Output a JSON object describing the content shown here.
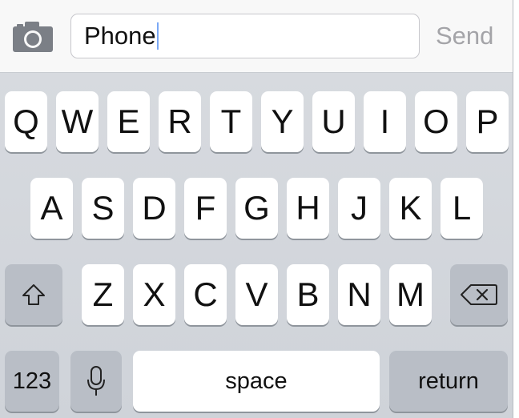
{
  "compose": {
    "camera_icon": "camera-icon",
    "message_value": "Phone",
    "send_label": "Send"
  },
  "keyboard": {
    "row1": [
      "Q",
      "W",
      "E",
      "R",
      "T",
      "Y",
      "U",
      "I",
      "O",
      "P"
    ],
    "row2": [
      "A",
      "S",
      "D",
      "F",
      "G",
      "H",
      "J",
      "K",
      "L"
    ],
    "row3": [
      "Z",
      "X",
      "C",
      "V",
      "B",
      "N",
      "M"
    ],
    "shift_icon": "shift-icon",
    "delete_icon": "backspace-icon",
    "numbers_label": "123",
    "mic_icon": "microphone-icon",
    "space_label": "space",
    "return_label": "return"
  },
  "colors": {
    "keyboard_bg": "#d1d5db",
    "key_bg": "#ffffff",
    "modifier_key_bg": "#b9bec6",
    "send_disabled": "#a4a4a8",
    "caret": "#7aa8f5"
  }
}
